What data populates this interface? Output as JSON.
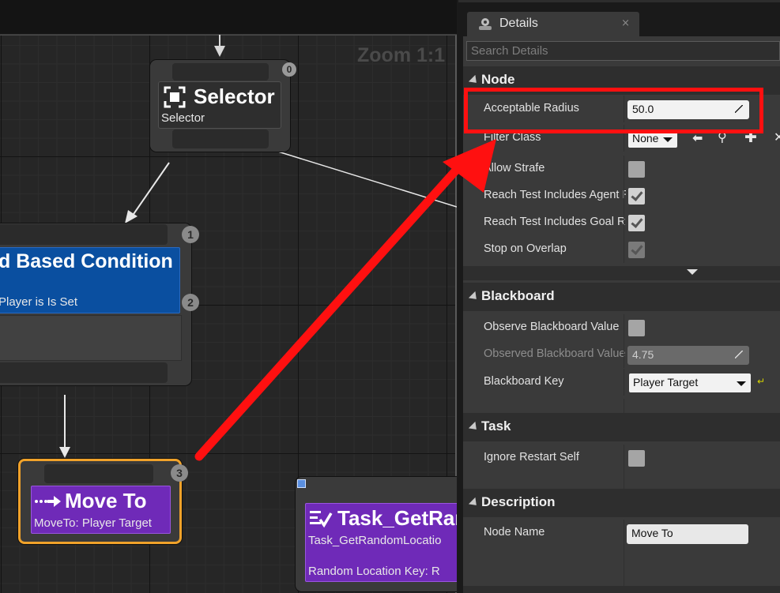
{
  "graph": {
    "zoom_label": "Zoom 1:1",
    "nodes": {
      "selector": {
        "title": "Selector",
        "subtitle": "Selector",
        "badge": "0"
      },
      "condition": {
        "title": "d Based Condition",
        "subtitle": "Player is Is Set",
        "badge_top": "1",
        "badge_bottom": "2"
      },
      "move_to": {
        "title": "Move To",
        "subtitle": "MoveTo: Player Target",
        "badge": "3"
      },
      "task": {
        "title": "Task_GetRan",
        "subtitle": "Task_GetRandomLocatio",
        "detail": "Random Location Key: R"
      }
    }
  },
  "details": {
    "tab_label": "Details",
    "close_label": "×",
    "search_placeholder": "Search Details",
    "categories": {
      "node": "Node",
      "blackboard": "Blackboard",
      "task": "Task",
      "description": "Description"
    },
    "node_props": {
      "acceptable_radius_label": "Acceptable Radius",
      "acceptable_radius_value": "50.0",
      "filter_class_label": "Filter Class",
      "filter_class_value": "None",
      "allow_strafe_label": "Allow Strafe",
      "reach_agent_label": "Reach Test Includes Agent Radius",
      "reach_goal_label": "Reach Test Includes Goal Radius",
      "stop_overlap_label": "Stop on Overlap"
    },
    "blackboard_props": {
      "observe_label": "Observe Blackboard Value",
      "observed_tolerance_label": "Observed Blackboard Value Tolerance",
      "observed_tolerance_value": "4.75",
      "key_label": "Blackboard Key",
      "key_value": "Player Target"
    },
    "task_props": {
      "ignore_restart_label": "Ignore Restart Self"
    },
    "description_props": {
      "node_name_label": "Node Name",
      "node_name_value": "Move To"
    }
  },
  "colors": {
    "highlight": "#ff1010",
    "condition_node": "#0a4fa0",
    "task_node": "#6f2ab8",
    "selected_outline": "#f0a22a"
  }
}
